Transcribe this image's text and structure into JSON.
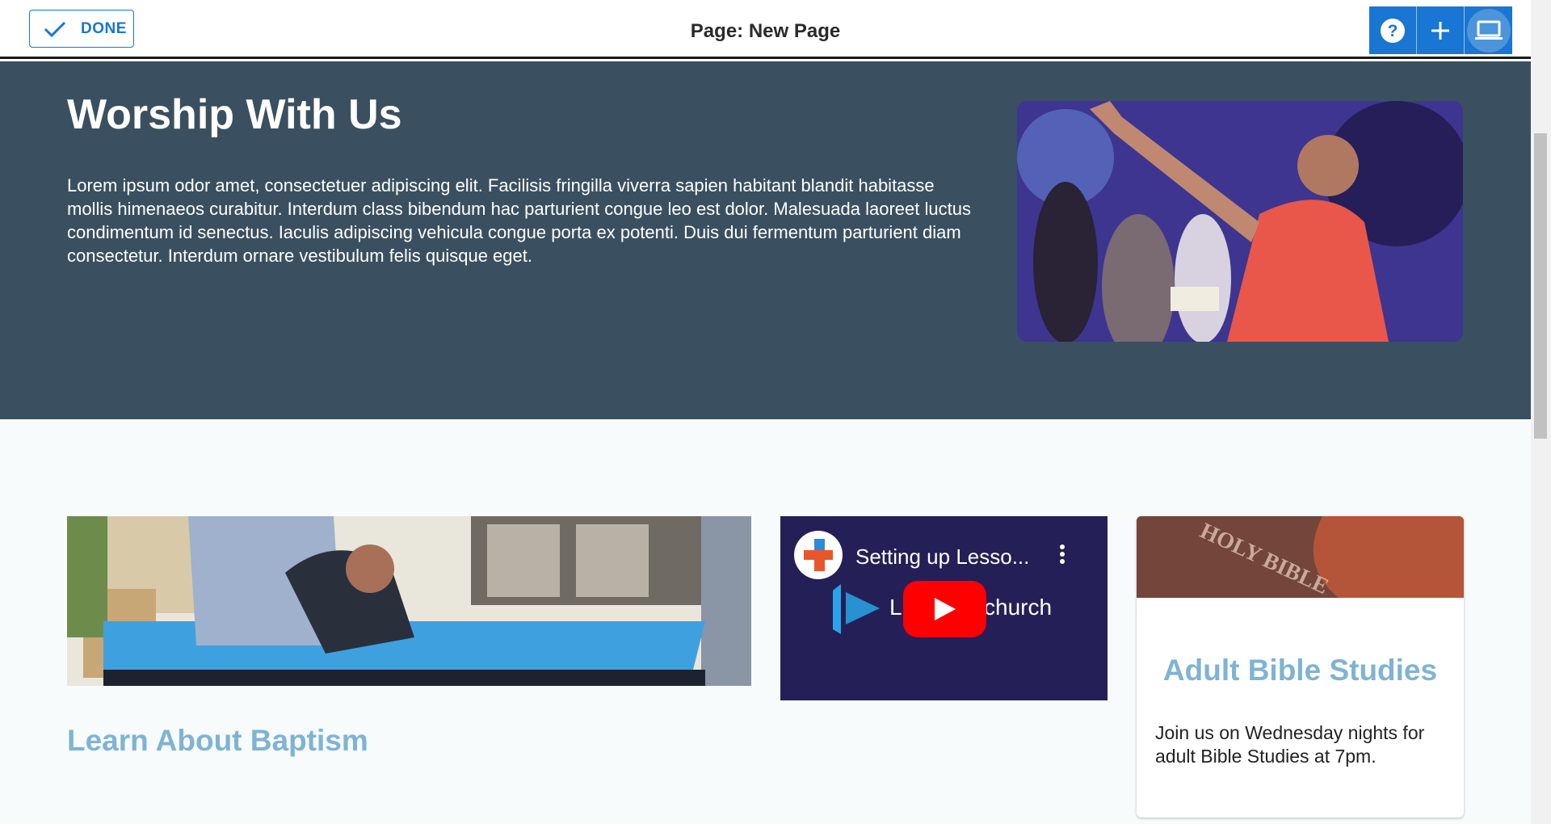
{
  "toolbar": {
    "done_label": "DONE",
    "page_title": "Page: New Page",
    "accent": "#1976d2",
    "buttons": [
      "help-icon",
      "add-icon",
      "laptop-icon"
    ]
  },
  "hero": {
    "title": "Worship With Us",
    "body": "Lorem ipsum odor amet, consectetuer adipiscing elit. Facilisis fringilla viverra sapien habitant blandit habitasse mollis himenaeos curabitur. Interdum class bibendum hac parturient congue leo est dolor. Malesuada laoreet luctus condimentum id senectus. Iaculis adipiscing vehicula congue porta ex potenti. Duis dui fermentum parturient diam consectetur. Interdum ornare vestibulum felis quisque eget.",
    "background": "#3a5060"
  },
  "baptism": {
    "title": "Learn About Baptism"
  },
  "video": {
    "title": "Setting up Lesso...",
    "brand_left": "L",
    "brand_right": "church"
  },
  "bible": {
    "image_text": "HOLY BIBLE",
    "title": "Adult Bible Studies",
    "body": "Join us on Wednesday nights for adult Bible Studies at 7pm."
  }
}
